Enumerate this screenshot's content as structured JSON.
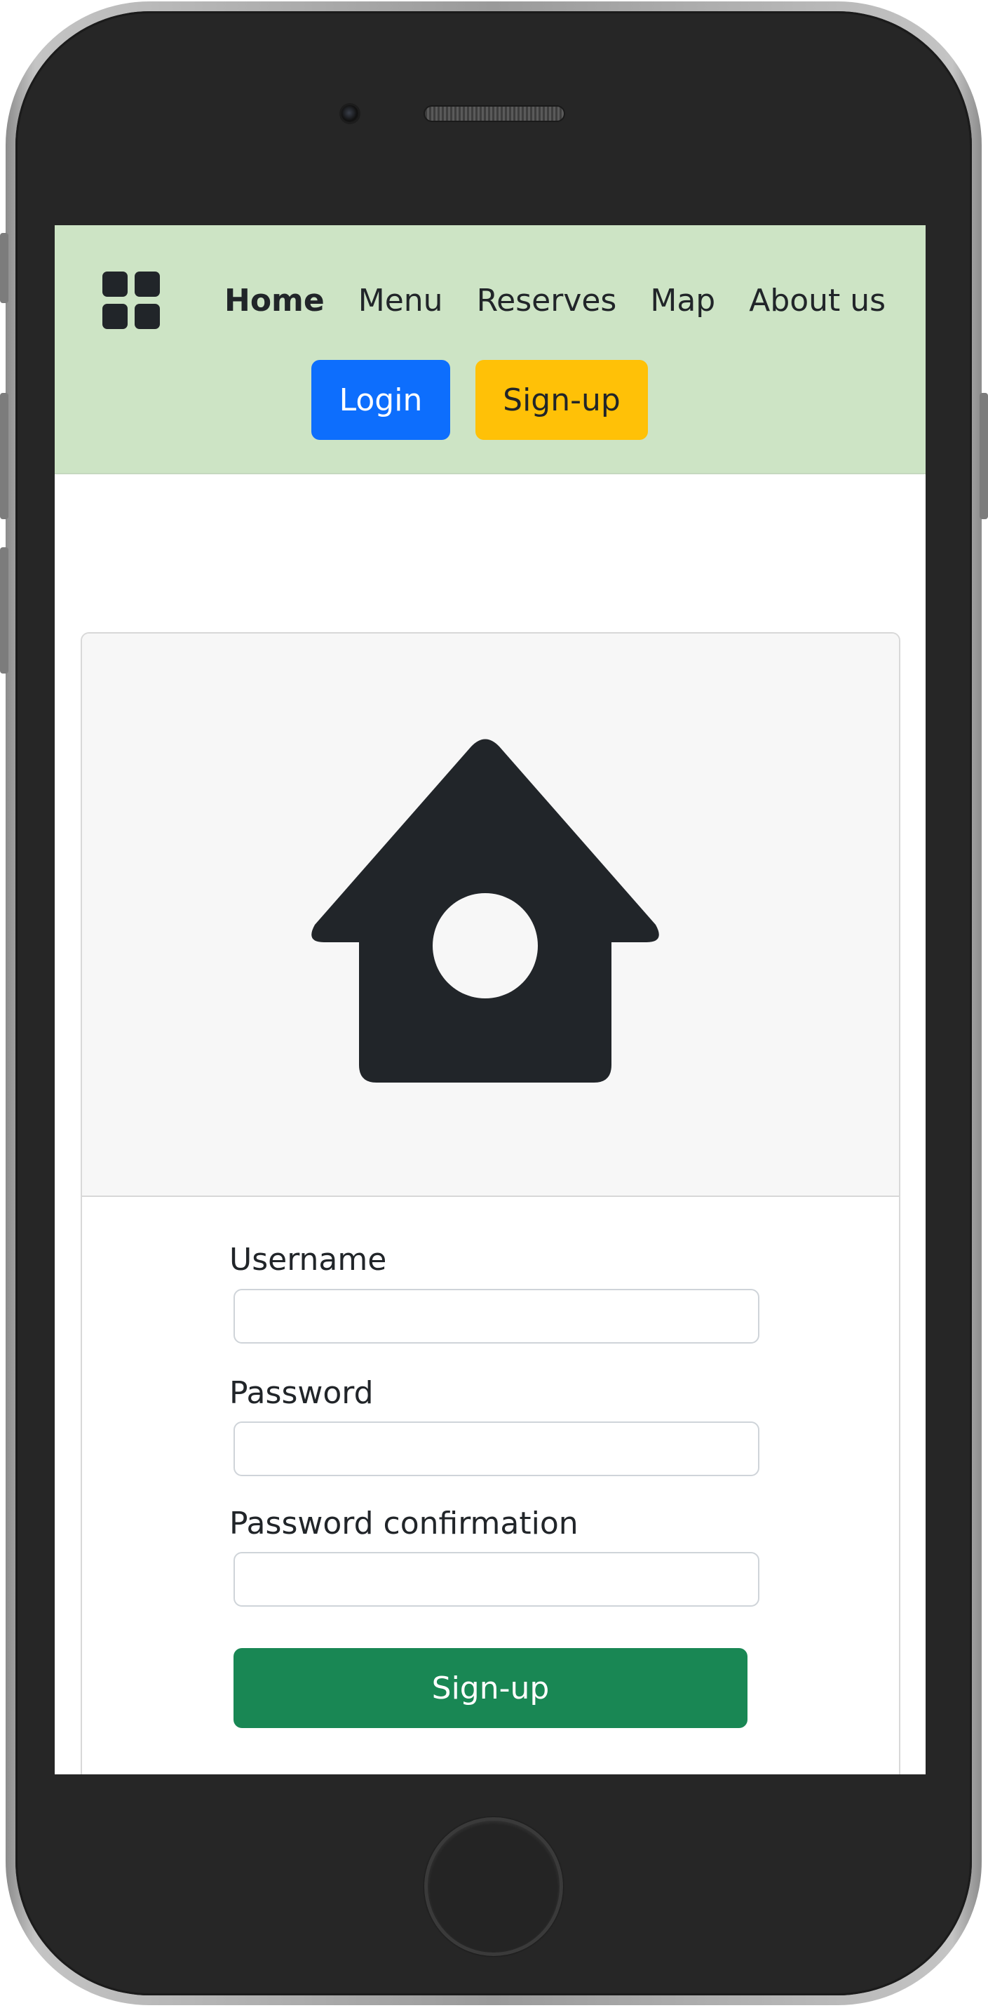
{
  "navbar": {
    "background": "#cde4c5",
    "menu_icon": "grid-icon",
    "links": [
      {
        "label": "Home",
        "active": true
      },
      {
        "label": "Menu",
        "active": false
      },
      {
        "label": "Reserves",
        "active": false
      },
      {
        "label": "Map",
        "active": false
      },
      {
        "label": "About us",
        "active": false
      }
    ],
    "login_label": "Login",
    "signup_label": "Sign-up",
    "login_color": "#0d6efd",
    "signup_color": "#ffc107"
  },
  "card": {
    "header_icon": "house-icon",
    "form": {
      "username_label": "Username",
      "username_value": "",
      "password_label": "Password",
      "password_value": "",
      "password_confirmation_label": "Password confirmation",
      "password_confirmation_value": "",
      "submit_label": "Sign-up",
      "submit_color": "#198754"
    }
  }
}
